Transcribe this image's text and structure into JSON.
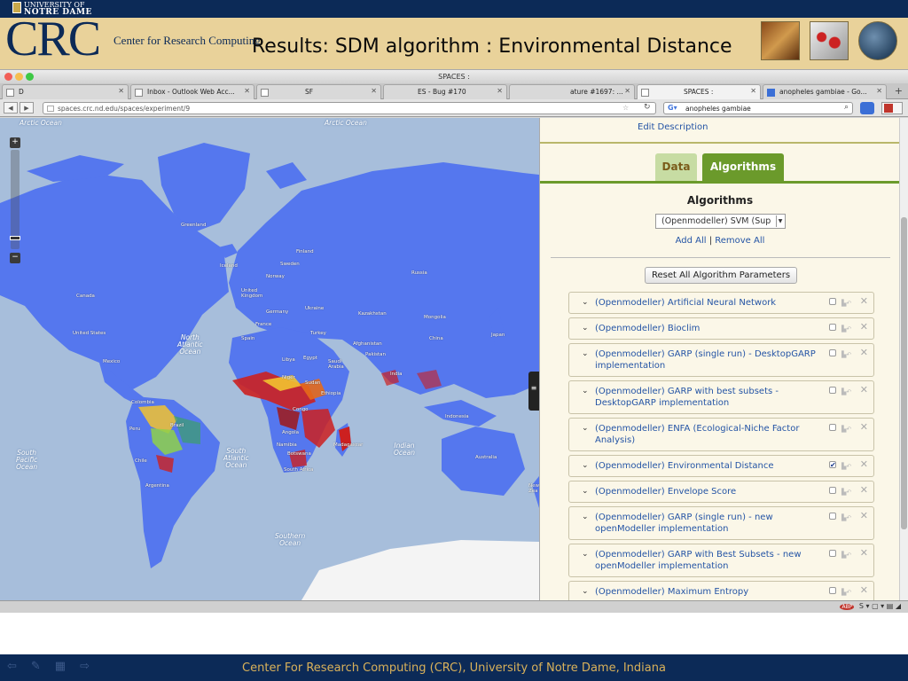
{
  "slide": {
    "university_line1": "UNIVERSITY OF",
    "university_line2": "NOTRE DAME",
    "logo_text": "CRC",
    "logo_subtitle": "Center for Research Computing",
    "title": "Results: SDM algorithm : Environmental Distance",
    "footer": "Center For Research Computing (CRC), University of Notre Dame, Indiana"
  },
  "browser": {
    "window_title": "SPACES :",
    "tabs": [
      {
        "label": "D"
      },
      {
        "label": "Inbox - Outlook Web Acc..."
      },
      {
        "label": "SF"
      },
      {
        "label": "ES - Bug #170"
      },
      {
        "label": "ature #1697: ..."
      },
      {
        "label": "SPACES :"
      },
      {
        "label": "anopheles gambiae - Go..."
      }
    ],
    "url": "spaces.crc.nd.edu/spaces/experiment/9",
    "search_value": "anopheles gambiae"
  },
  "map": {
    "zoom_in": "+",
    "zoom_out": "−",
    "oceans": [
      {
        "label": "Arctic\nOcean",
        "key": "arctic-left"
      },
      {
        "label": "Arctic\nOcean",
        "key": "arctic-right"
      },
      {
        "label": "North\nAtlantic\nOcean",
        "key": "north-atlantic"
      },
      {
        "label": "South\nPacific\nOcean",
        "key": "south-pacific"
      },
      {
        "label": "South\nAtlantic\nOcean",
        "key": "south-atlantic"
      },
      {
        "label": "Indian\nOcean",
        "key": "indian"
      },
      {
        "label": "Southern\nOcean",
        "key": "southern"
      }
    ],
    "countries": [
      "Greenland",
      "Iceland",
      "Finland",
      "Sweden",
      "Norway",
      "Russia",
      "Canada",
      "United Kingdom",
      "Germany",
      "Ukraine",
      "France",
      "Kazakhstan",
      "Mongolia",
      "United States",
      "Spain",
      "Turkey",
      "Afghanistan",
      "China",
      "Japan",
      "Libya",
      "Egypt",
      "Saudi Arabia",
      "Pakistan",
      "India",
      "Mexico",
      "Niger",
      "Ethiopia",
      "Sudan",
      "Colombia",
      "Congo",
      "Indonesia",
      "Peru",
      "Brazil",
      "Angola",
      "Namibia",
      "Madagascar",
      "Botswana",
      "Chile",
      "South Africa",
      "Australia",
      "Argentina",
      "New Zea"
    ]
  },
  "panel": {
    "edit_description": "Edit Description",
    "tab_data": "Data",
    "tab_algorithms": "Algorithms",
    "heading": "Algorithms",
    "selected_algorithm": "(Openmodeller) SVM (Sup",
    "add_all": "Add All",
    "separator": "|",
    "remove_all": "Remove All",
    "reset_button": "Reset All Algorithm Parameters",
    "algorithms": [
      {
        "name": "(Openmodeller) Artificial Neural Network",
        "checked": false
      },
      {
        "name": "(Openmodeller) Bioclim",
        "checked": false
      },
      {
        "name": "(Openmodeller) GARP (single run) - DesktopGARP implementation",
        "checked": false
      },
      {
        "name": "(Openmodeller) GARP with best subsets - DesktopGARP implementation",
        "checked": false
      },
      {
        "name": "(Openmodeller) ENFA (Ecological-Niche Factor Analysis)",
        "checked": false
      },
      {
        "name": "(Openmodeller) Environmental Distance",
        "checked": true
      },
      {
        "name": "(Openmodeller) Envelope Score",
        "checked": false
      },
      {
        "name": "(Openmodeller) GARP (single run) - new openModeller implementation",
        "checked": false
      },
      {
        "name": "(Openmodeller) GARP with Best Subsets - new openModeller implementation",
        "checked": false
      },
      {
        "name": "(Openmodeller) Maximum Entropy",
        "checked": false
      }
    ]
  },
  "colors": {
    "navy": "#0c2a57",
    "banner_gold": "#e9d29a",
    "footer_text": "#d9b15a",
    "land_blue": "#5577ee",
    "ocean": "#a7bedb",
    "tab_green": "#6b9a2b",
    "link_blue": "#2454a5"
  },
  "icons": [
    "back-arrow-icon",
    "forward-arrow-icon",
    "star-icon",
    "reload-icon",
    "search-icon",
    "chevron-down-icon",
    "checkbox-icon",
    "close-icon",
    "layers-icon"
  ]
}
